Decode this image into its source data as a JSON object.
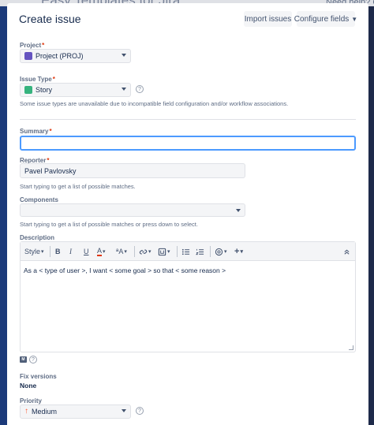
{
  "background": {
    "title": "Easy Templates for Jira",
    "help": "Need help? Ch"
  },
  "dialog": {
    "title": "Create issue",
    "import_label": "Import issues",
    "configure_label": "Configure fields"
  },
  "fields": {
    "project": {
      "label": "Project",
      "value": "Project (PROJ)"
    },
    "issue_type": {
      "label": "Issue Type",
      "value": "Story",
      "hint": "Some issue types are unavailable due to incompatible field configuration and/or workflow associations."
    },
    "summary": {
      "label": "Summary",
      "value": ""
    },
    "reporter": {
      "label": "Reporter",
      "value": "Pavel Pavlovsky",
      "hint": "Start typing to get a list of possible matches."
    },
    "components": {
      "label": "Components",
      "value": "",
      "hint": "Start typing to get a list of possible matches or press down to select."
    },
    "description": {
      "label": "Description",
      "text": "As a < type of user >, I want < some goal > so that < some reason >",
      "toolbar": {
        "style_label": "Style",
        "bold": "B",
        "italic": "I",
        "underline": "U",
        "color": "A",
        "more_format": "ªA",
        "markdown_badge": "M"
      }
    },
    "fix_versions": {
      "label": "Fix versions",
      "value": "None"
    },
    "priority": {
      "label": "Priority",
      "value": "Medium"
    }
  },
  "required_mark": "*",
  "help_mark": "?",
  "icons": {
    "project": "project-avatar-icon",
    "issue_type": "story-icon",
    "priority": "arrow-up-icon"
  },
  "colors": {
    "accent": "#4c9aff",
    "required": "#de350b",
    "story": "#36b37e",
    "project": "#6554c0",
    "priority_medium": "#ff5630"
  }
}
